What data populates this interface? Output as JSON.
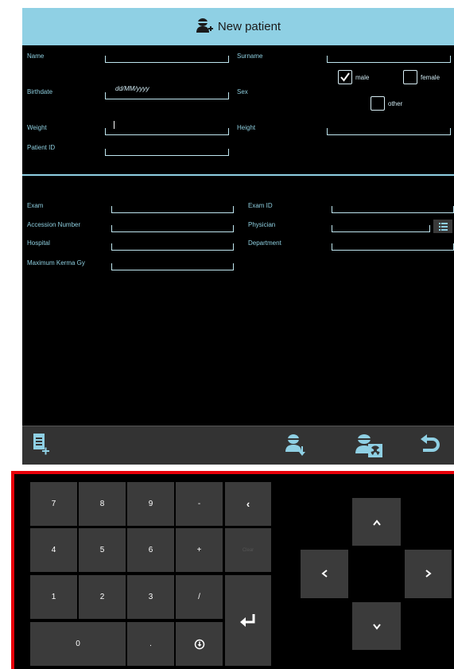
{
  "header": {
    "title": "New patient"
  },
  "patient": {
    "name_label": "Name",
    "surname_label": "Surname",
    "birthdate_label": "Birthdate",
    "birthdate_placeholder": "dd/MM/yyyy",
    "sex_label": "Sex",
    "sex_options": {
      "male": "male",
      "female": "female",
      "other": "other"
    },
    "sex_selected": "male",
    "weight_label": "Weight",
    "height_label": "Height",
    "patient_id_label": "Patient ID"
  },
  "exam": {
    "exam_label": "Exam",
    "exam_id_label": "Exam ID",
    "accession_label": "Accession Number",
    "physician_label": "Physician",
    "hospital_label": "Hospital",
    "department_label": "Department",
    "kerma_label": "Maximum Kerma Gy"
  },
  "toolbar": {
    "icons": [
      "new-form-icon",
      "patient-download-icon",
      "patient-radiation-icon",
      "undo-icon"
    ]
  },
  "keypad": {
    "k7": "7",
    "k8": "8",
    "k9": "9",
    "kminus": "-",
    "k4": "4",
    "k5": "5",
    "k6": "6",
    "kplus": "+",
    "clear": "Clear",
    "k1": "1",
    "k2": "2",
    "k3": "3",
    "kslash": "/",
    "k0": "0",
    "kdot": ".",
    "backspace": "‹",
    "enter": "↵"
  },
  "colors": {
    "accent": "#8fd0e4",
    "background": "#000000",
    "key": "#3b3b3b",
    "highlight_border": "#e8000a"
  }
}
